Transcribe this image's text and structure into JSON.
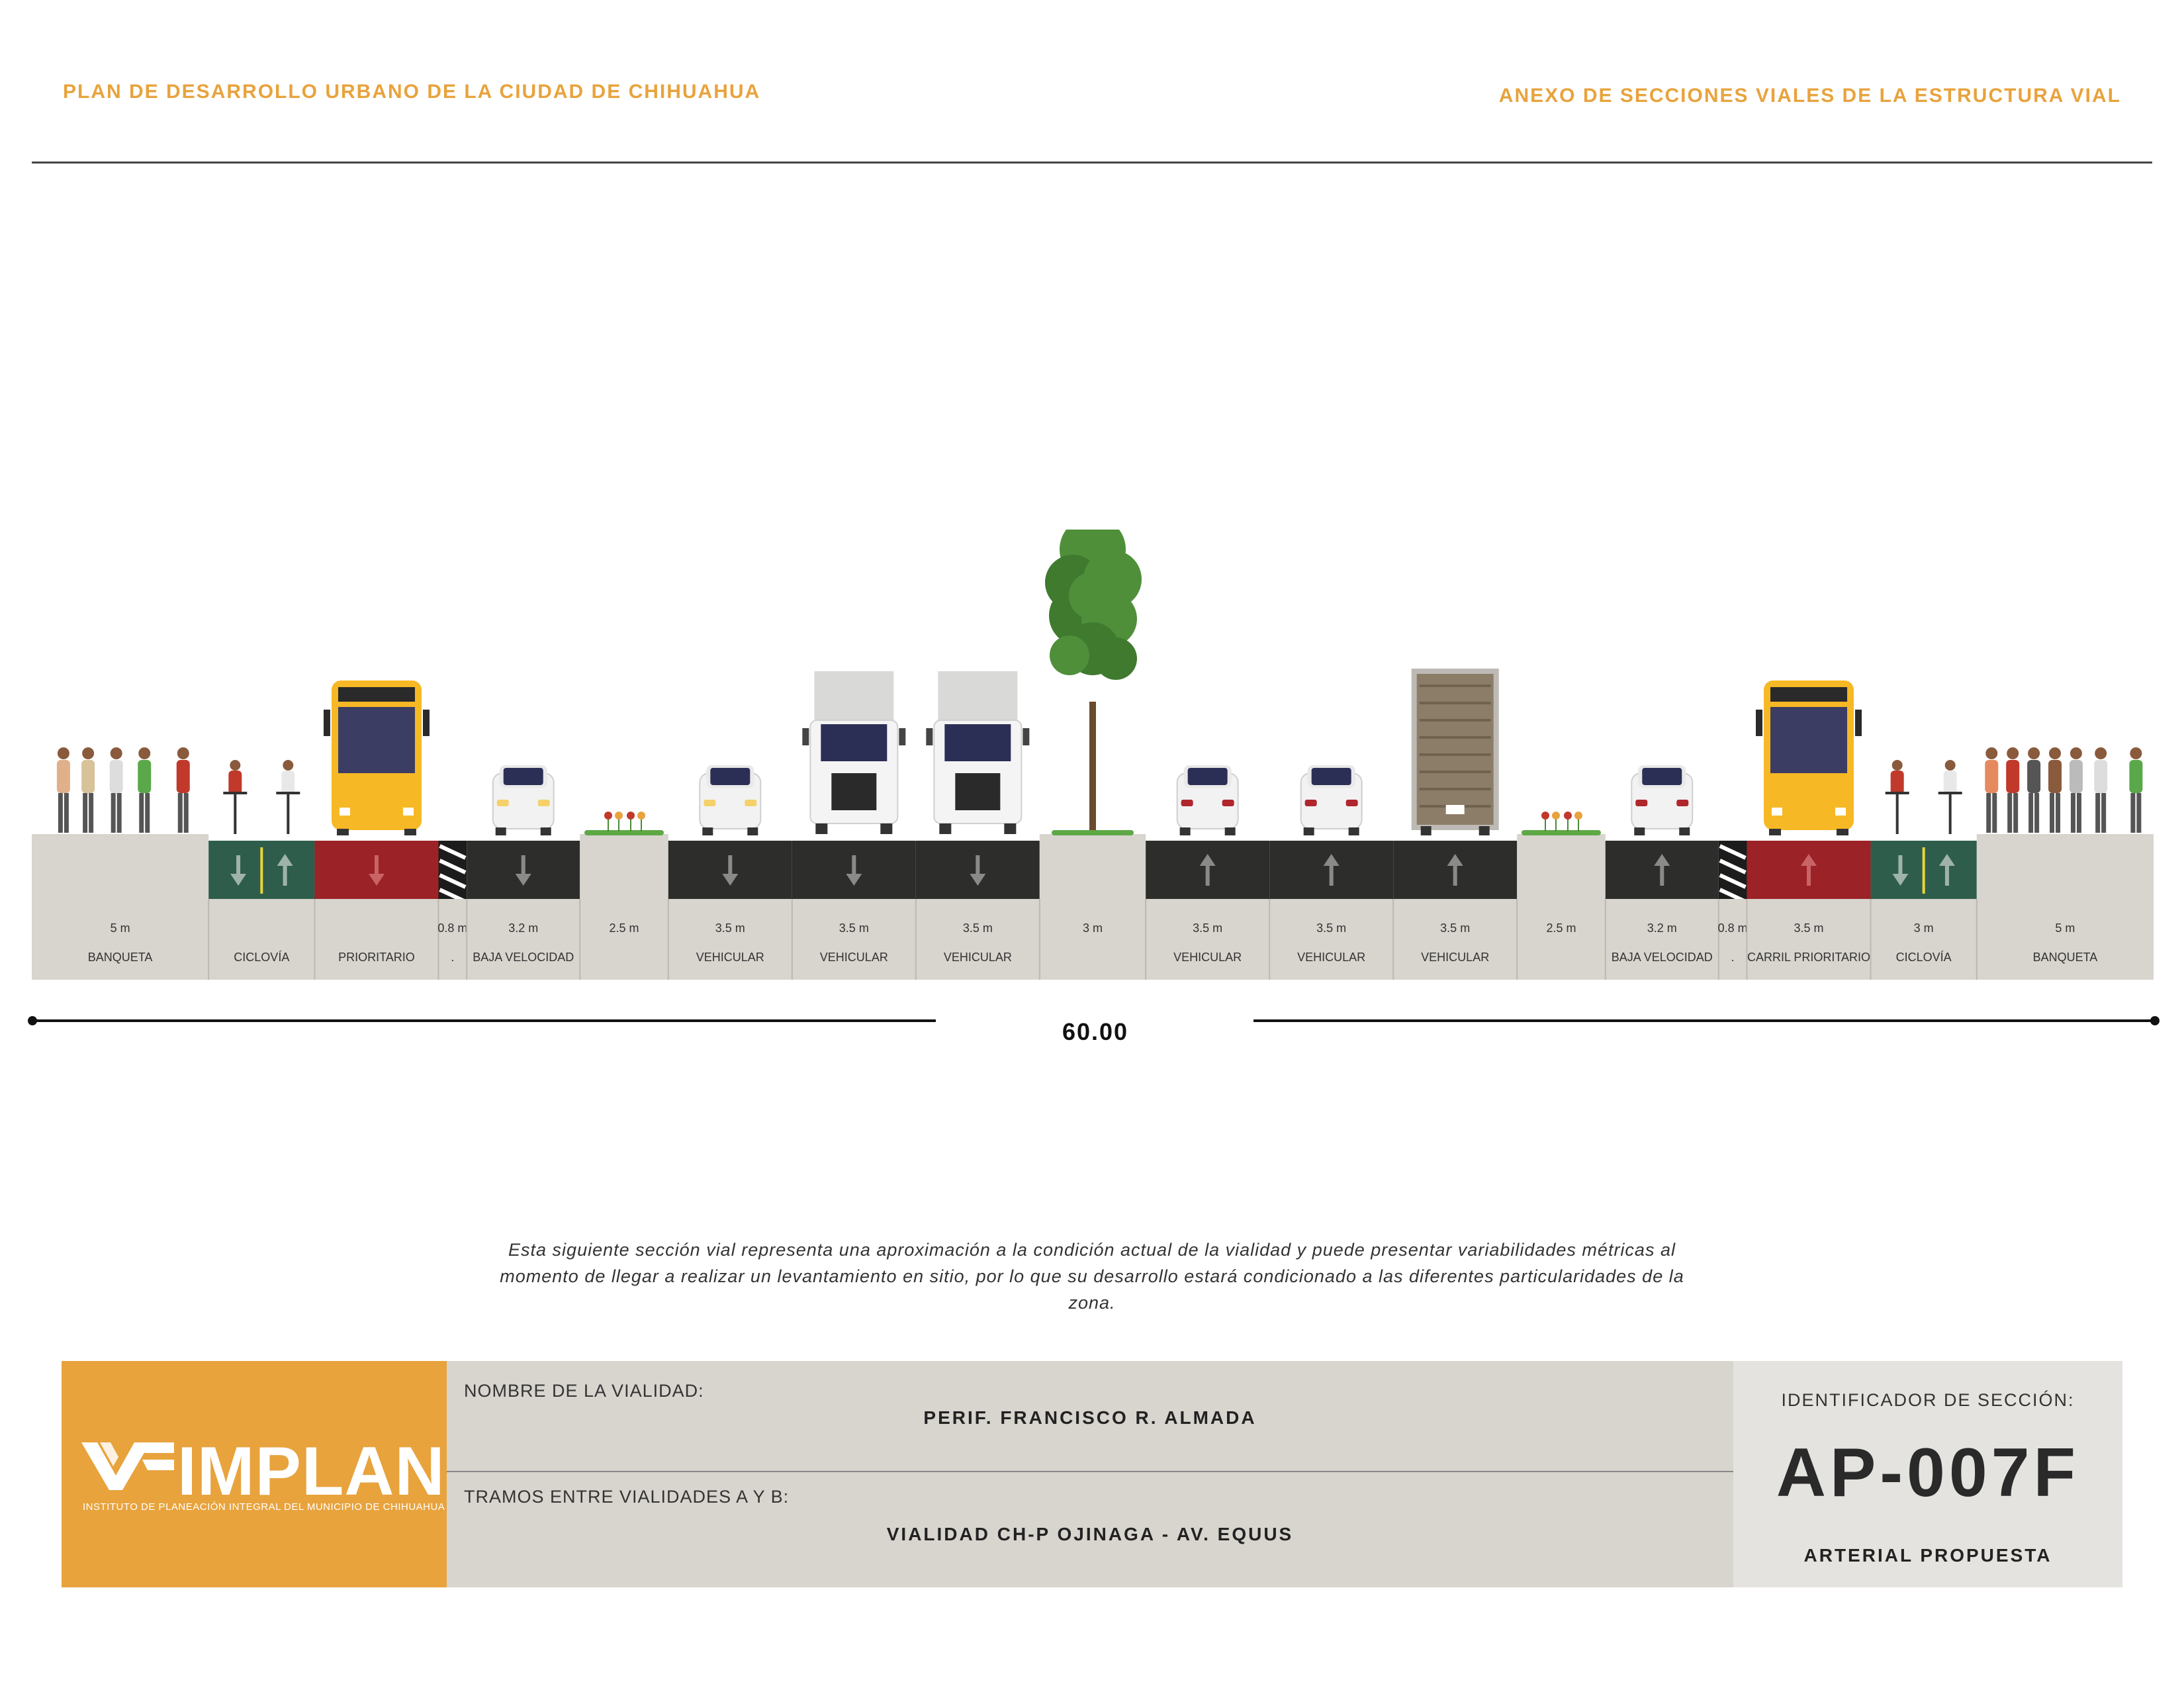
{
  "header": {
    "left_title": "PLAN DE DESARROLLO URBANO DE LA CIUDAD DE CHIHUAHUA",
    "right_title": "ANEXO DE SECCIONES VIALES DE LA ESTRUCTURA VIAL"
  },
  "section": {
    "total_width": "60.00",
    "segments": [
      {
        "width": "5 m",
        "label": "BANQUETA",
        "kind": "sidewalk",
        "meters": 5
      },
      {
        "width": "",
        "label": "CICLOVÍA",
        "kind": "bike",
        "meters": 3
      },
      {
        "width": "",
        "label": "PRIORITARIO",
        "kind": "bus",
        "meters": 3.5,
        "direction": "down"
      },
      {
        "width": "0.8 m",
        "label": ".",
        "kind": "buffer",
        "meters": 0.8
      },
      {
        "width": "3.2 m",
        "label": "BAJA VELOCIDAD",
        "kind": "road",
        "meters": 3.2,
        "direction": "down"
      },
      {
        "width": "2.5 m",
        "label": "",
        "kind": "median",
        "meters": 2.5
      },
      {
        "width": "3.5 m",
        "label": "VEHICULAR",
        "kind": "road",
        "meters": 3.5,
        "direction": "down"
      },
      {
        "width": "3.5 m",
        "label": "VEHICULAR",
        "kind": "road",
        "meters": 3.5,
        "direction": "down"
      },
      {
        "width": "3.5 m",
        "label": "VEHICULAR",
        "kind": "road",
        "meters": 3.5,
        "direction": "down"
      },
      {
        "width": "3 m",
        "label": "",
        "kind": "median",
        "meters": 3
      },
      {
        "width": "3.5 m",
        "label": "VEHICULAR",
        "kind": "road",
        "meters": 3.5,
        "direction": "up"
      },
      {
        "width": "3.5 m",
        "label": "VEHICULAR",
        "kind": "road",
        "meters": 3.5,
        "direction": "up"
      },
      {
        "width": "3.5 m",
        "label": "VEHICULAR",
        "kind": "road",
        "meters": 3.5,
        "direction": "up"
      },
      {
        "width": "2.5 m",
        "label": "",
        "kind": "median",
        "meters": 2.5
      },
      {
        "width": "3.2 m",
        "label": "BAJA VELOCIDAD",
        "kind": "road",
        "meters": 3.2,
        "direction": "up"
      },
      {
        "width": "0.8 m",
        "label": ".",
        "kind": "buffer",
        "meters": 0.8
      },
      {
        "width": "3.5 m",
        "label": "CARRIL PRIORITARIO",
        "kind": "bus",
        "meters": 3.5,
        "direction": "up"
      },
      {
        "width": "3 m",
        "label": "CICLOVÍA",
        "kind": "bike",
        "meters": 3
      },
      {
        "width": "5 m",
        "label": "BANQUETA",
        "kind": "sidewalk",
        "meters": 5
      }
    ],
    "colors": {
      "sidewalk": "#d8d4ce",
      "road": "#2d2d2b",
      "bike": "#2f5d4c",
      "bus": "#9b2226",
      "bus_vehicle": "#f7b825",
      "tree": "#4f8f3a",
      "accent": "#e8a33d"
    }
  },
  "note": "Esta siguiente sección vial representa una aproximación a la condición actual de la vialidad y puede presentar variabilidades métricas al momento de llegar a realizar un levantamiento en sitio, por lo que su desarrollo estará condicionado a las diferentes particularidades de la zona.",
  "footer": {
    "logo_word": "IMPLAN",
    "logo_sub": "INSTITUTO DE PLANEACIÓN INTEGRAL DEL MUNICIPIO DE CHIHUAHUA",
    "name_label": "NOMBRE DE LA VIALIDAD:",
    "name_value": "PERIF. FRANCISCO R. ALMADA",
    "tramos_label": "TRAMOS ENTRE VIALIDADES A Y B:",
    "tramos_value": "VIALIDAD CH-P OJINAGA - AV. EQUUS",
    "id_label": "IDENTIFICADOR DE SECCIÓN:",
    "id_code": "AP-007F",
    "id_type": "ARTERIAL PROPUESTA"
  }
}
